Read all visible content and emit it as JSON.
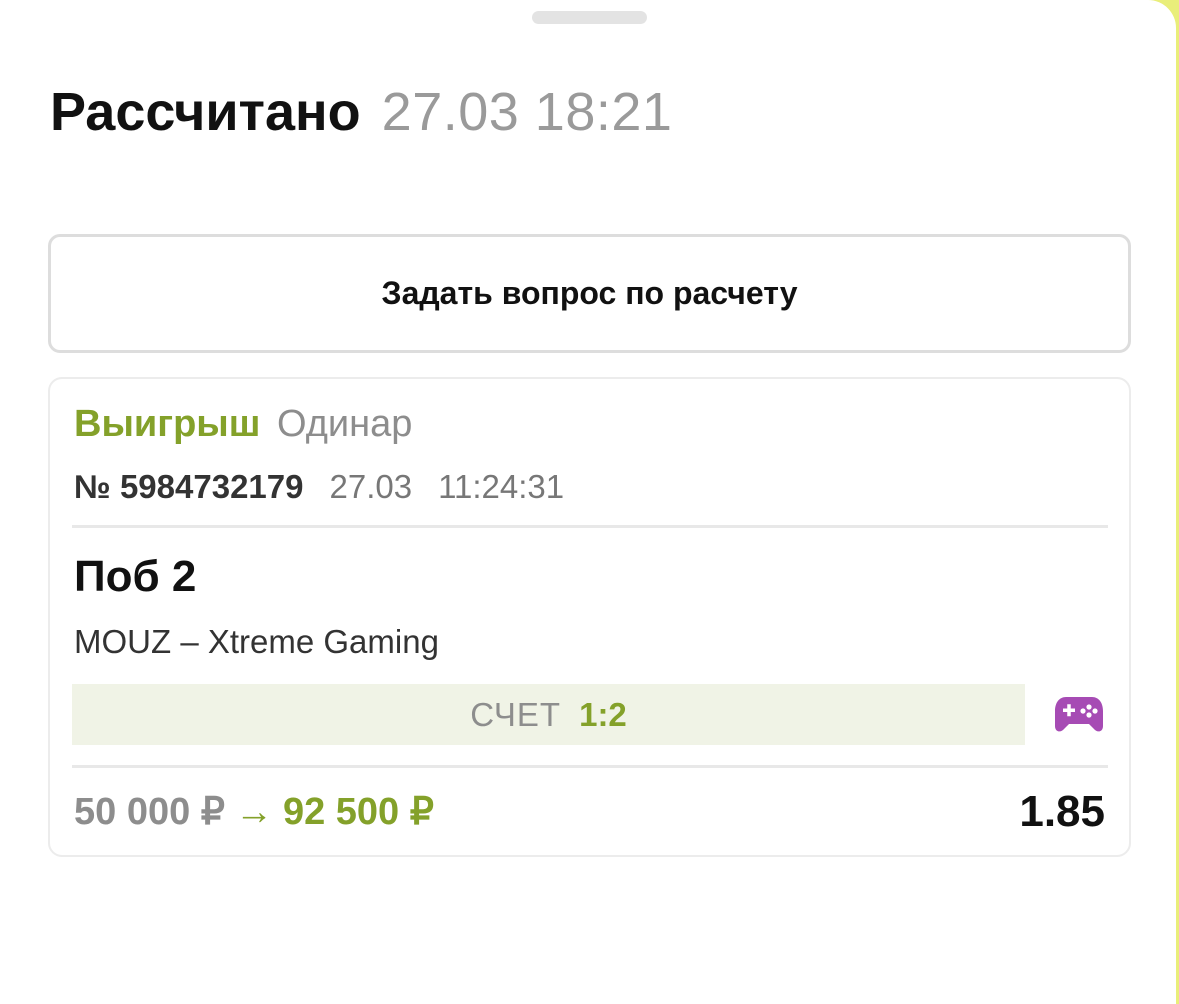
{
  "header": {
    "status_title": "Рассчитано",
    "settled_datetime": "27.03 18:21"
  },
  "actions": {
    "ask_question_label": "Задать вопрос по расчету"
  },
  "bet": {
    "result": "Выигрыш",
    "bet_type": "Одинар",
    "number": "№ 5984732179",
    "date": "27.03",
    "time": "11:24:31",
    "outcome": "Поб 2",
    "match": "MOUZ – Xtreme Gaming",
    "score_label": "СЧЕТ",
    "score_value": "1:2",
    "sport_icon": "gamepad-icon",
    "stake": "50 000 ₽",
    "arrow": "→",
    "payout": "92 500 ₽",
    "odds": "1.85"
  },
  "colors": {
    "win_green": "#84a12a",
    "esports_purple": "#a64bb4",
    "score_bg": "#f0f3e6"
  }
}
